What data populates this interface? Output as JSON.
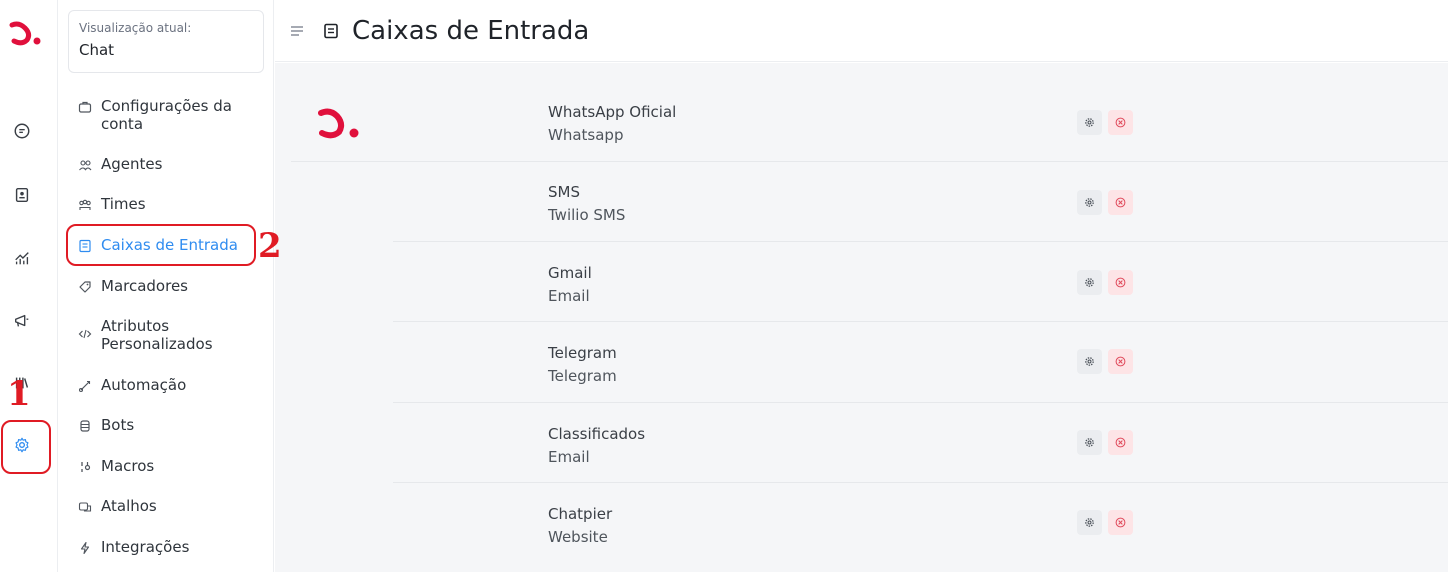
{
  "colors": {
    "brand": "#e0103c",
    "accent": "#2f8cf0",
    "annotation": "#e01b24"
  },
  "rail": {
    "logo_icon": "brand-logo-icon",
    "items": [
      {
        "name": "conversations",
        "icon": "chat-bubble-icon"
      },
      {
        "name": "contacts",
        "icon": "contact-card-icon"
      },
      {
        "name": "reports",
        "icon": "chart-icon"
      },
      {
        "name": "campaigns",
        "icon": "megaphone-icon"
      },
      {
        "name": "library",
        "icon": "library-icon"
      },
      {
        "name": "settings",
        "icon": "gear-icon",
        "active": true
      }
    ]
  },
  "sidebar": {
    "view_label": "Visualização atual:",
    "view_value": "Chat",
    "items": [
      {
        "label": "Configurações da conta",
        "icon": "briefcase-icon"
      },
      {
        "label": "Agentes",
        "icon": "people-icon"
      },
      {
        "label": "Times",
        "icon": "team-icon"
      },
      {
        "label": "Caixas de Entrada",
        "icon": "inbox-icon",
        "active": true
      },
      {
        "label": "Marcadores",
        "icon": "tag-icon"
      },
      {
        "label": "Atributos Personalizados",
        "icon": "code-icon"
      },
      {
        "label": "Automação",
        "icon": "automation-icon"
      },
      {
        "label": "Bots",
        "icon": "bot-icon"
      },
      {
        "label": "Macros",
        "icon": "macro-icon"
      },
      {
        "label": "Atalhos",
        "icon": "shortcut-icon"
      },
      {
        "label": "Integrações",
        "icon": "lightning-icon"
      }
    ]
  },
  "header": {
    "title": "Caixas de Entrada",
    "menu_icon": "hamburger-icon",
    "title_icon": "inbox-icon"
  },
  "inboxes": [
    {
      "name": "WhatsApp Oficial",
      "type": "Whatsapp"
    },
    {
      "name": "SMS",
      "type": "Twilio SMS"
    },
    {
      "name": "Gmail",
      "type": "Email"
    },
    {
      "name": "Telegram",
      "type": "Telegram"
    },
    {
      "name": "Classificados",
      "type": "Email"
    },
    {
      "name": "Chatpier",
      "type": "Website"
    }
  ],
  "annotations": {
    "step1": "1",
    "step2": "2"
  }
}
